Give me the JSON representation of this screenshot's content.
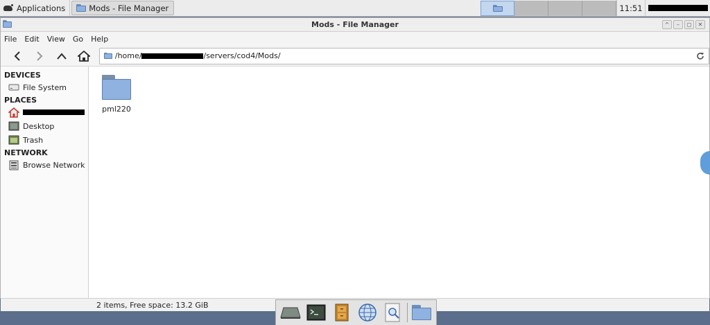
{
  "top_panel": {
    "applications_label": "Applications",
    "task_label": "Mods - File Manager",
    "clock": "11:51",
    "workspaces": [
      "ws1",
      "ws2",
      "ws3",
      "ws4"
    ]
  },
  "window": {
    "title": "Mods - File Manager",
    "controls": [
      "^",
      "–",
      "◻",
      "✕"
    ]
  },
  "menu": {
    "file": "File",
    "edit": "Edit",
    "view": "View",
    "go": "Go",
    "help": "Help"
  },
  "toolbar": {
    "path_prefix": "/home/",
    "path_suffix": "/servers/cod4/Mods/"
  },
  "sidebar": {
    "devices_header": "DEVICES",
    "file_system": "File System",
    "places_header": "PLACES",
    "desktop": "Desktop",
    "trash": "Trash",
    "network_header": "NETWORK",
    "browse_network": "Browse Network"
  },
  "files": [
    {
      "name": "pml220",
      "type": "folder"
    }
  ],
  "status": "2 items, Free space: 13.2 GiB",
  "colors": {
    "folder": "#8fb2e0",
    "accent": "#5f9ddb",
    "desktop_bg": "#5b6f8c"
  }
}
